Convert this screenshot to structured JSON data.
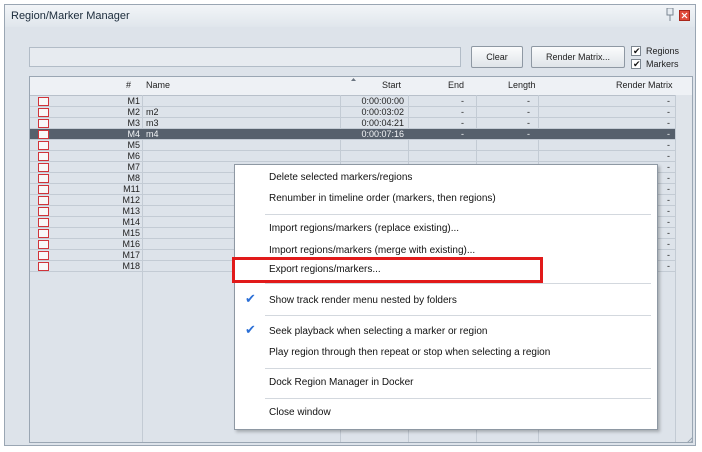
{
  "window": {
    "title": "Region/Marker Manager"
  },
  "toolbar": {
    "filter_value": "",
    "clear_label": "Clear",
    "render_matrix_label": "Render Matrix...",
    "regions_label": "Regions",
    "regions_checked": true,
    "markers_label": "Markers",
    "markers_checked": true
  },
  "table": {
    "columns": [
      "#",
      "Name",
      "Start",
      "End",
      "Length",
      "Render Matrix"
    ],
    "sorted_column": "Start",
    "rows": [
      {
        "num": "M1",
        "name": "",
        "start": "0:00:00:00",
        "end": "-",
        "length": "-",
        "render_matrix": "-"
      },
      {
        "num": "M2",
        "name": "m2",
        "start": "0:00:03:02",
        "end": "-",
        "length": "-",
        "render_matrix": "-"
      },
      {
        "num": "M3",
        "name": "m3",
        "start": "0:00:04:21",
        "end": "-",
        "length": "-",
        "render_matrix": "-"
      },
      {
        "num": "M4",
        "name": "m4",
        "start": "0:00:07:16",
        "end": "-",
        "length": "-",
        "render_matrix": "-",
        "selected": true
      },
      {
        "num": "M5",
        "name": "",
        "start": "",
        "end": "",
        "length": "",
        "render_matrix": "-"
      },
      {
        "num": "M6",
        "name": "",
        "start": "",
        "end": "",
        "length": "",
        "render_matrix": "-"
      },
      {
        "num": "M7",
        "name": "",
        "start": "",
        "end": "",
        "length": "",
        "render_matrix": "-"
      },
      {
        "num": "M8",
        "name": "",
        "start": "",
        "end": "",
        "length": "",
        "render_matrix": "-"
      },
      {
        "num": "M11",
        "name": "",
        "start": "",
        "end": "",
        "length": "",
        "render_matrix": "-"
      },
      {
        "num": "M12",
        "name": "",
        "start": "",
        "end": "",
        "length": "",
        "render_matrix": "-"
      },
      {
        "num": "M13",
        "name": "",
        "start": "",
        "end": "",
        "length": "",
        "render_matrix": "-"
      },
      {
        "num": "M14",
        "name": "",
        "start": "",
        "end": "",
        "length": "",
        "render_matrix": "-"
      },
      {
        "num": "M15",
        "name": "",
        "start": "",
        "end": "",
        "length": "",
        "render_matrix": "-"
      },
      {
        "num": "M16",
        "name": "",
        "start": "",
        "end": "",
        "length": "",
        "render_matrix": "-"
      },
      {
        "num": "M17",
        "name": "",
        "start": "",
        "end": "",
        "length": "",
        "render_matrix": "-"
      },
      {
        "num": "M18",
        "name": "",
        "start": "",
        "end": "",
        "length": "",
        "render_matrix": "-"
      }
    ]
  },
  "context_menu": {
    "items": [
      {
        "label": "Delete selected markers/regions",
        "checked": false
      },
      {
        "label": "Renumber in timeline order (markers, then regions)",
        "checked": false
      },
      {
        "label": "Import regions/markers (replace existing)...",
        "checked": false
      },
      {
        "label": "Import regions/markers (merge with existing)...",
        "checked": false
      },
      {
        "label": "Export regions/markers...",
        "checked": false,
        "highlighted": true
      },
      {
        "label": "Show track render menu nested by folders",
        "checked": true
      },
      {
        "label": "Seek playback when selecting a marker or region",
        "checked": true
      },
      {
        "label": "Play region through then repeat or stop when selecting a region",
        "checked": false
      },
      {
        "label": "Dock Region Manager in Docker",
        "checked": false
      },
      {
        "label": "Close window",
        "checked": false
      }
    ]
  },
  "colors": {
    "highlight_box": "#e11a1a",
    "check_blue": "#2b6fd6",
    "marker_icon": "#d0343a",
    "selected_row": "#56606c"
  },
  "icons": [
    "pin-icon",
    "close-icon",
    "sort-asc-icon",
    "marker-icon",
    "checkmark-icon",
    "resize-grip-icon"
  ]
}
